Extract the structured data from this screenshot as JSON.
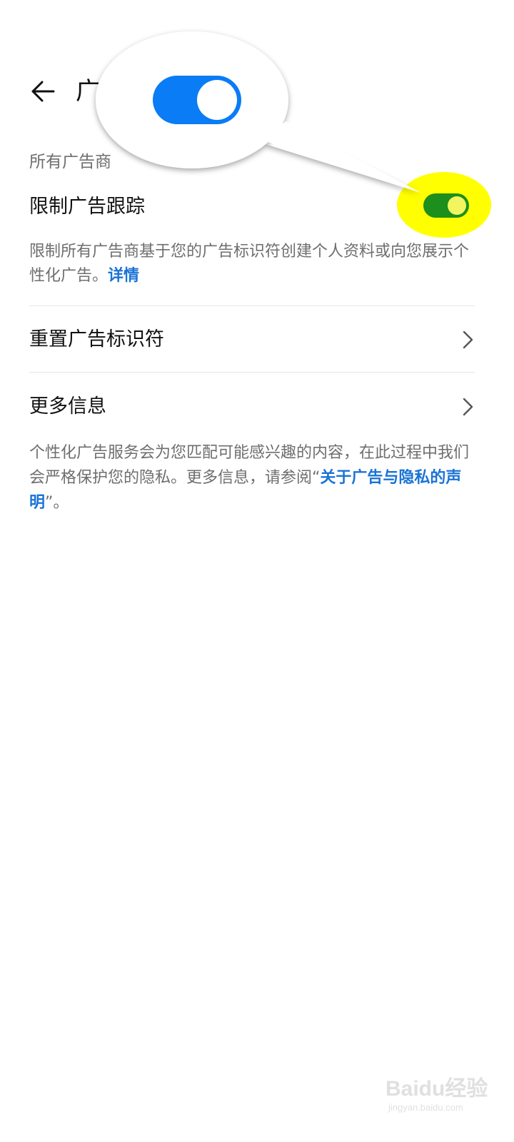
{
  "header": {
    "back_icon": "arrow-left-icon",
    "title": "广"
  },
  "section": {
    "title": "所有广告商"
  },
  "limit_tracking": {
    "label": "限制广告跟踪",
    "toggle_on": true,
    "toggle_color": "#1c8f1c",
    "highlight_color": "#ffff00",
    "description": "限制所有广告商基于您的广告标识符创建个人资料或向您展示个性化广告。",
    "details_link": "详情"
  },
  "rows": [
    {
      "label": "重置广告标识符",
      "icon": "chevron-right-icon"
    },
    {
      "label": "更多信息",
      "icon": "chevron-right-icon"
    }
  ],
  "footer": {
    "text_before": "个性化广告服务会为您匹配可能感兴趣的内容，在此过程中我们会严格保护您的隐私。更多信息，请参阅“",
    "link": "关于广告与隐私的声明",
    "text_after": "”。"
  },
  "callout": {
    "toggle_on": true,
    "toggle_color": "#0a7cf5"
  },
  "watermark": {
    "text": "Baidu经验",
    "sub": "jingyan.baidu.com"
  },
  "colors": {
    "link": "#1a73d6",
    "secondary_text": "#6e6e6e"
  }
}
